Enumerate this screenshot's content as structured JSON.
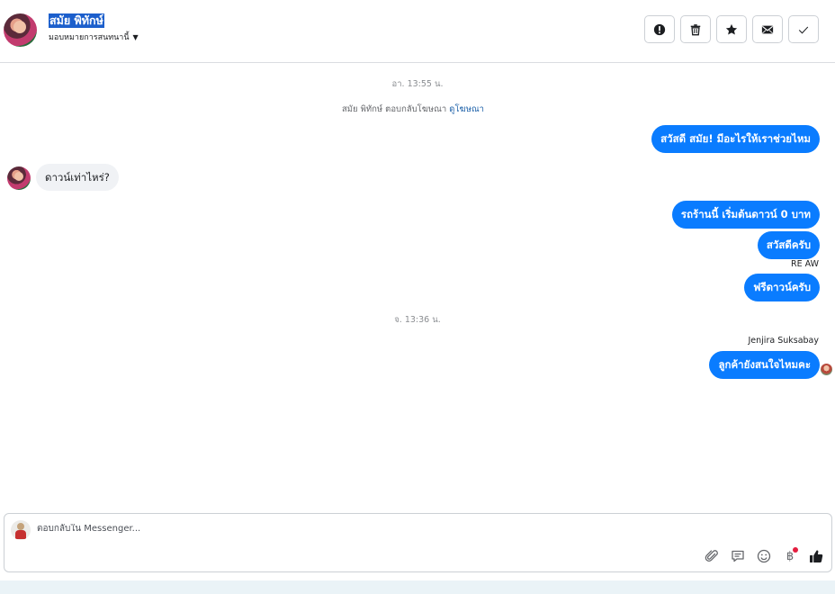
{
  "header": {
    "contact_name": "สมัย พิทักษ์",
    "assign_label": "มอบหมายการสนทนานี้",
    "actions": [
      {
        "icon": "alert-circle-icon",
        "name": "report-button"
      },
      {
        "icon": "trash-icon",
        "name": "delete-button"
      },
      {
        "icon": "star-icon",
        "name": "star-button"
      },
      {
        "icon": "envelope-icon",
        "name": "mark-unread-button"
      },
      {
        "icon": "check-icon",
        "name": "mark-done-button"
      }
    ]
  },
  "thread": {
    "timestamp_1": "อา. 13:55 น.",
    "reply_note": "สมัย พิทักษ์ ตอบกลับโฆษณา",
    "reply_note_link": "ดูโฆษณา",
    "msg_out_1": "สวัสดี สมัย! มีอะไรให้เราช่วยไหม",
    "msg_in_1": "ดาวน์เท่าไหร่?",
    "msg_out_2": "รถร้านนี้ เริ่มต้นดาวน์ 0 บาท",
    "msg_out_3": "สวัสดีครับ",
    "sender_1": "RE AW",
    "msg_out_4": "ฟรีดาวน์ครับ",
    "timestamp_2": "จ. 13:36 น.",
    "sender_2": "Jenjira Suksabay",
    "msg_out_5": "ลูกค้ายังสนใจไหมคะ"
  },
  "composer": {
    "placeholder": "ตอบกลับใน Messenger...",
    "tools": [
      "paperclip-icon",
      "saved-reply-icon",
      "emoji-icon",
      "baht-icon",
      "thumbs-up-icon"
    ]
  },
  "colors": {
    "outgoing_bubble": "#0a7cff",
    "incoming_bubble": "#f0f2f5",
    "link": "#1a5fa8",
    "notification_dot": "#e41e3f"
  }
}
